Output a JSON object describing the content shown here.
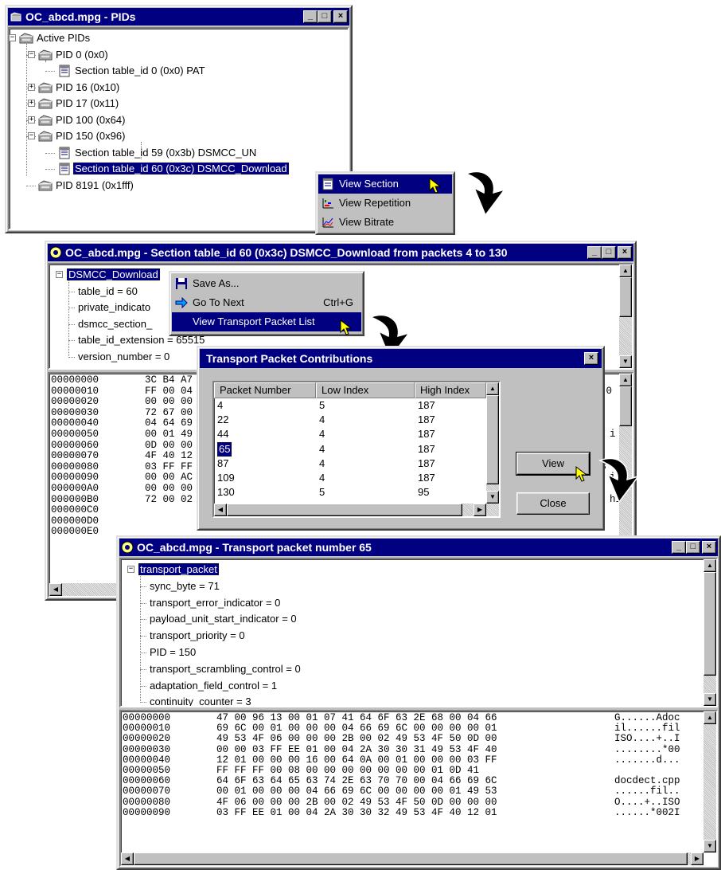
{
  "pids_window": {
    "title": "OC_abcd.mpg - PIDs",
    "tree": [
      {
        "label": "Active PIDs",
        "level": 0,
        "expander": "-",
        "icon": "folder-icon"
      },
      {
        "label": "PID 0 (0x0)",
        "level": 1,
        "expander": "-",
        "icon": "folder-icon"
      },
      {
        "label": "Section table_id 0 (0x0) PAT",
        "level": 2,
        "expander": "",
        "icon": "section-icon"
      },
      {
        "label": "PID 16 (0x10)",
        "level": 1,
        "expander": "+",
        "icon": "folder-icon"
      },
      {
        "label": "PID 17 (0x11)",
        "level": 1,
        "expander": "+",
        "icon": "folder-icon"
      },
      {
        "label": "PID 100 (0x64)",
        "level": 1,
        "expander": "+",
        "icon": "folder-icon"
      },
      {
        "label": "PID 150 (0x96)",
        "level": 1,
        "expander": "-",
        "icon": "folder-icon"
      },
      {
        "label": "Section table_id 59 (0x3b) DSMCC_UN",
        "level": 2,
        "expander": "",
        "icon": "section-icon"
      },
      {
        "label": "Section table_id 60 (0x3c) DSMCC_Download",
        "level": 2,
        "expander": "",
        "icon": "section-icon",
        "selected": true
      },
      {
        "label": "PID 8191 (0x1fff)",
        "level": 1,
        "expander": "",
        "icon": "folder-icon"
      }
    ]
  },
  "context_menu_1": {
    "items": [
      {
        "label": "View Section",
        "icon": "section-icon",
        "highlighted": true
      },
      {
        "label": "View Repetition",
        "icon": "repetition-chart-icon",
        "highlighted": false
      },
      {
        "label": "View Bitrate",
        "icon": "bitrate-chart-icon",
        "highlighted": false
      }
    ]
  },
  "section_window": {
    "title": "OC_abcd.mpg - Section table_id 60 (0x3c) DSMCC_Download from packets 4 to 130",
    "tree": [
      {
        "label": "DSMCC_Download",
        "level": 0,
        "selected": true
      },
      {
        "label": "table_id = 60",
        "level": 1
      },
      {
        "label": "private_indicato",
        "level": 1
      },
      {
        "label": "dsmcc_section_",
        "level": 1
      },
      {
        "label": "table_id_extension = 65515",
        "level": 1
      },
      {
        "label": "version_number = 0",
        "level": 1
      }
    ],
    "hex_rows": [
      {
        "offset": "00000000",
        "bytes": "3C B4 A7"
      },
      {
        "offset": "00000010",
        "bytes": "FF 00 04"
      },
      {
        "offset": "00000020",
        "bytes": "00 00 00"
      },
      {
        "offset": "00000030",
        "bytes": "72 67 00"
      },
      {
        "offset": "00000040",
        "bytes": "04 64 69"
      },
      {
        "offset": "00000050",
        "bytes": "00 01 49"
      },
      {
        "offset": "00000060",
        "bytes": "0D 00 00"
      },
      {
        "offset": "00000070",
        "bytes": "4F 40 12"
      },
      {
        "offset": "00000080",
        "bytes": "03 FF FF"
      },
      {
        "offset": "00000090",
        "bytes": "00 00 AC"
      },
      {
        "offset": "000000A0",
        "bytes": "00 00 00"
      },
      {
        "offset": "000000B0",
        "bytes": "72 00 02"
      },
      {
        "offset": "000000C0",
        "bytes": ""
      },
      {
        "offset": "000000D0",
        "bytes": ""
      },
      {
        "offset": "000000E0",
        "bytes": ""
      }
    ],
    "ascii_fragments": [
      "*0",
      "B",
      "i",
      "hi",
      "i"
    ]
  },
  "context_menu_2": {
    "items": [
      {
        "label": "Save As...",
        "icon": "floppy-disk-icon",
        "shortcut": "",
        "highlighted": false
      },
      {
        "label": "Go To Next",
        "icon": "right-arrow-icon",
        "shortcut": "Ctrl+G",
        "highlighted": false
      },
      {
        "label": "View Transport Packet List",
        "icon": "",
        "shortcut": "",
        "highlighted": true
      }
    ]
  },
  "dialog": {
    "title": "Transport Packet Contributions",
    "columns": [
      "Packet Number",
      "Low Index",
      "High Index"
    ],
    "rows": [
      {
        "packet": "4",
        "low": "5",
        "high": "187"
      },
      {
        "packet": "22",
        "low": "4",
        "high": "187"
      },
      {
        "packet": "44",
        "low": "4",
        "high": "187"
      },
      {
        "packet": "65",
        "low": "4",
        "high": "187",
        "selected": true
      },
      {
        "packet": "87",
        "low": "4",
        "high": "187"
      },
      {
        "packet": "109",
        "low": "4",
        "high": "187"
      },
      {
        "packet": "130",
        "low": "5",
        "high": "95"
      }
    ],
    "view_button": "View",
    "close_button": "Close",
    "close_x": "×"
  },
  "packet_window": {
    "title": "OC_abcd.mpg - Transport packet number 65",
    "tree": [
      {
        "label": "transport_packet",
        "level": 0,
        "selected": true
      },
      {
        "label": "sync_byte = 71",
        "level": 1
      },
      {
        "label": "transport_error_indicator = 0",
        "level": 1
      },
      {
        "label": "payload_unit_start_indicator = 0",
        "level": 1
      },
      {
        "label": "transport_priority = 0",
        "level": 1
      },
      {
        "label": "PID = 150",
        "level": 1
      },
      {
        "label": "transport_scrambling_control = 0",
        "level": 1
      },
      {
        "label": "adaptation_field_control = 1",
        "level": 1
      },
      {
        "label": "continuity_counter = 3",
        "level": 1
      }
    ],
    "hex_rows": [
      {
        "offset": "00000000",
        "bytes": "47 00 96 13 00 01 07 41 64 6F 63 2E 68 00 04 66",
        "ascii": "G......Adoc"
      },
      {
        "offset": "00000010",
        "bytes": "69 6C 00 01 00 00 00 04 66 69 6C 00 00 00 00 01",
        "ascii": "il......fil"
      },
      {
        "offset": "00000020",
        "bytes": "49 53 4F 06 00 00 00 2B 00 02 49 53 4F 50 0D 00",
        "ascii": "ISO....+..I"
      },
      {
        "offset": "00000030",
        "bytes": "00 00 03 FF EE 01 00 04 2A 30 30 31 49 53 4F 40",
        "ascii": "........*00"
      },
      {
        "offset": "00000040",
        "bytes": "12 01 00 00 00 16 00 64 0A 00 01 00 00 00 03 FF",
        "ascii": ".......d..."
      },
      {
        "offset": "00000050",
        "bytes": "FF FF FF 00 08 00 00 00 00 00 00 00 01 0D 41",
        "ascii": ""
      },
      {
        "offset": "00000060",
        "bytes": "64 6F 63 64 65 63 74 2E 63 70 70 00 04 66 69 6C",
        "ascii": "docdect.cpp"
      },
      {
        "offset": "00000070",
        "bytes": "00 01 00 00 00 04 66 69 6C 00 00 00 00 01 49 53",
        "ascii": "......fil.."
      },
      {
        "offset": "00000080",
        "bytes": "4F 06 00 00 00 2B 00 02 49 53 4F 50 0D 00 00 00",
        "ascii": "O....+..ISO"
      },
      {
        "offset": "00000090",
        "bytes": "03 FF EE 01 00 04 2A 30 30 32 49 53 4F 40 12 01",
        "ascii": "......*002I"
      }
    ]
  },
  "titlebar_buttons": {
    "minimize": "_",
    "maximize": "□",
    "close": "×"
  },
  "colors": {
    "titlebar": "#000080",
    "face": "#c0c0c0",
    "highlight": "#000080"
  }
}
